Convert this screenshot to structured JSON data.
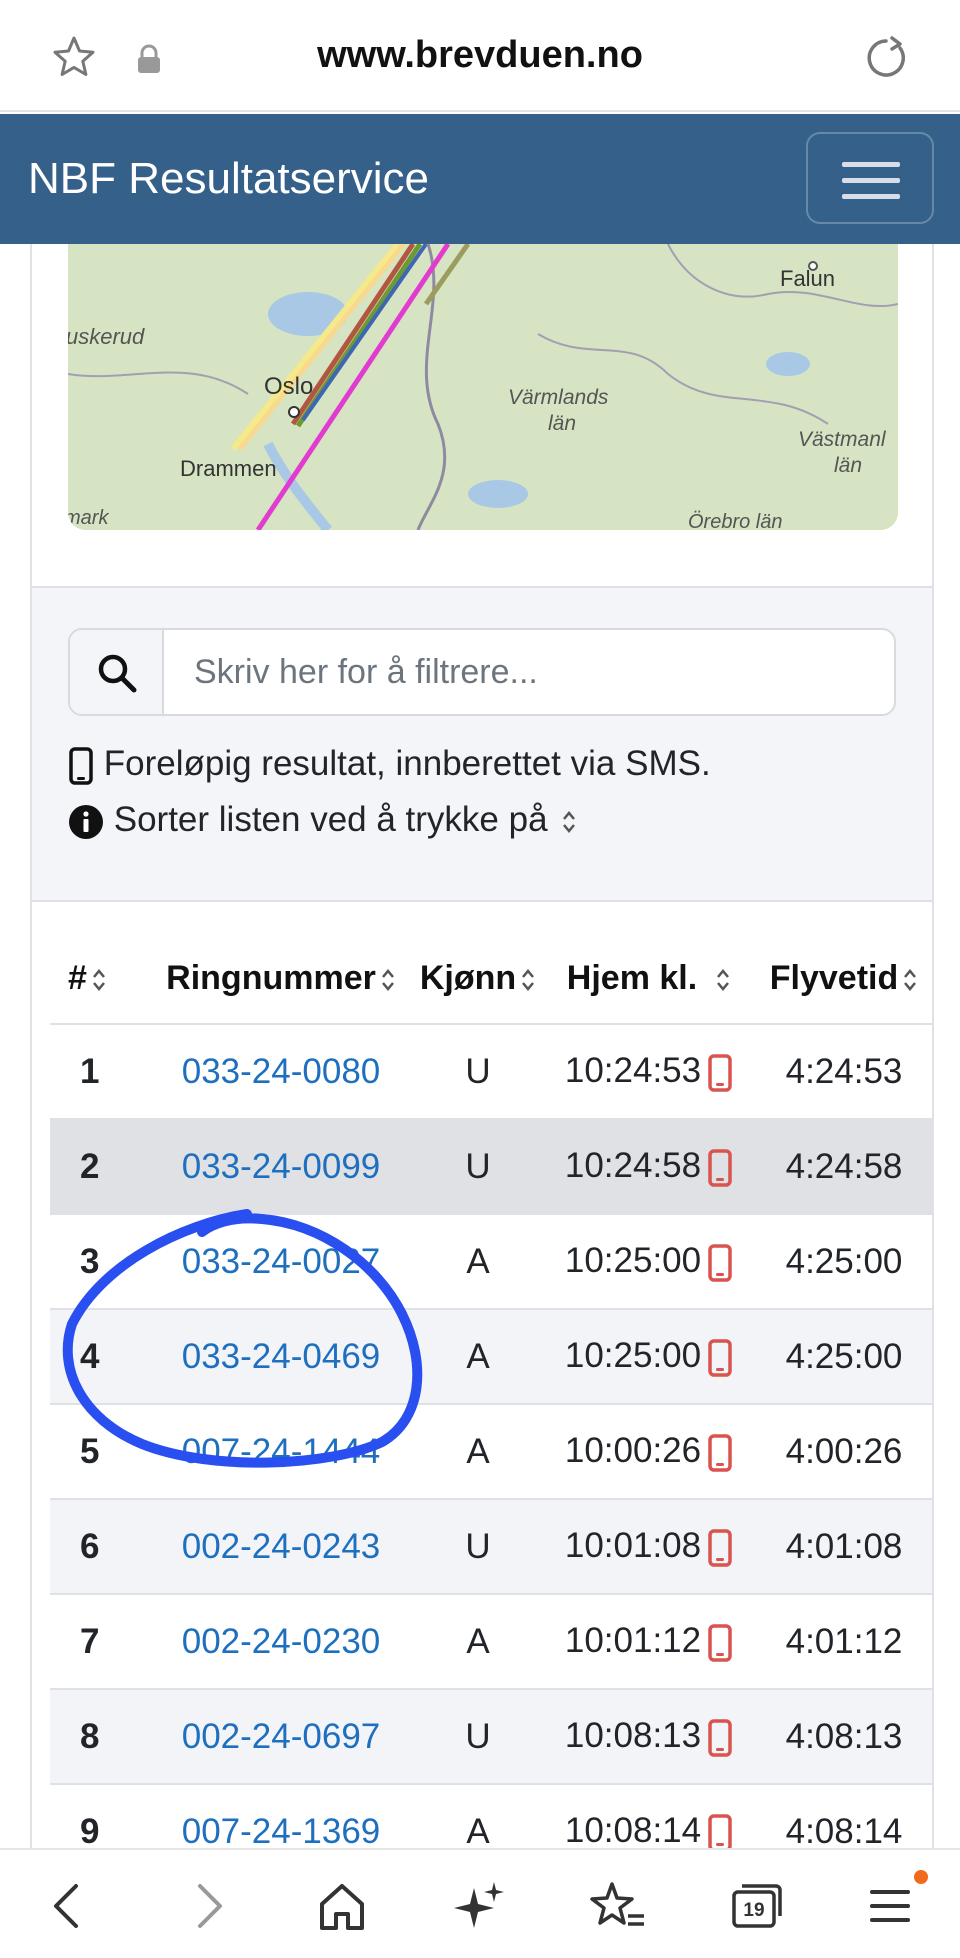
{
  "browser": {
    "url": "www.brevduen.no",
    "tabs_count": "19",
    "icons": [
      "star-icon",
      "lock-icon",
      "reload-icon",
      "back-icon",
      "forward-icon",
      "home-icon",
      "sparkle-icon",
      "favorites-icon",
      "tabs-icon",
      "menu-icon"
    ]
  },
  "navbar": {
    "brand": "NBF Resultatservice"
  },
  "map": {
    "labels": {
      "buskerud": "uskerud",
      "oslo": "Oslo",
      "drammen": "Drammen",
      "varmlands": "Värmlands",
      "lan1": "län",
      "falun": "Falun",
      "vastman": "Västmanl",
      "lan2": "län",
      "orebro": "Örebro län",
      "mark": "mark"
    }
  },
  "filter": {
    "placeholder": "Skriv her for å filtrere...",
    "sms_note": "Foreløpig resultat, innberettet via SMS.",
    "sort_note": "Sorter listen ved å trykke på"
  },
  "table": {
    "headers": {
      "rank": "#",
      "ring": "Ringnummer",
      "sex": "Kjønn",
      "home": "Hjem kl.",
      "flight": "Flyvetid"
    },
    "rows": [
      {
        "rank": "1",
        "ring": "033-24-0080",
        "sex": "U",
        "home": "10:24:53",
        "flight": "4:24:53"
      },
      {
        "rank": "2",
        "ring": "033-24-0099",
        "sex": "U",
        "home": "10:24:58",
        "flight": "4:24:58"
      },
      {
        "rank": "3",
        "ring": "033-24-0027",
        "sex": "A",
        "home": "10:25:00",
        "flight": "4:25:00"
      },
      {
        "rank": "4",
        "ring": "033-24-0469",
        "sex": "A",
        "home": "10:25:00",
        "flight": "4:25:00"
      },
      {
        "rank": "5",
        "ring": "007-24-1444",
        "sex": "A",
        "home": "10:00:26",
        "flight": "4:00:26"
      },
      {
        "rank": "6",
        "ring": "002-24-0243",
        "sex": "U",
        "home": "10:01:08",
        "flight": "4:01:08"
      },
      {
        "rank": "7",
        "ring": "002-24-0230",
        "sex": "A",
        "home": "10:01:12",
        "flight": "4:01:12"
      },
      {
        "rank": "8",
        "ring": "002-24-0697",
        "sex": "U",
        "home": "10:08:13",
        "flight": "4:08:13"
      },
      {
        "rank": "9",
        "ring": "007-24-1369",
        "sex": "A",
        "home": "10:08:14",
        "flight": "4:08:14"
      }
    ]
  },
  "colors": {
    "navbar": "#34608a",
    "link": "#1f6fbf",
    "phone_icon": "#d9534f",
    "annotation": "#2a4ff0",
    "notification_dot": "#f26b1d"
  }
}
